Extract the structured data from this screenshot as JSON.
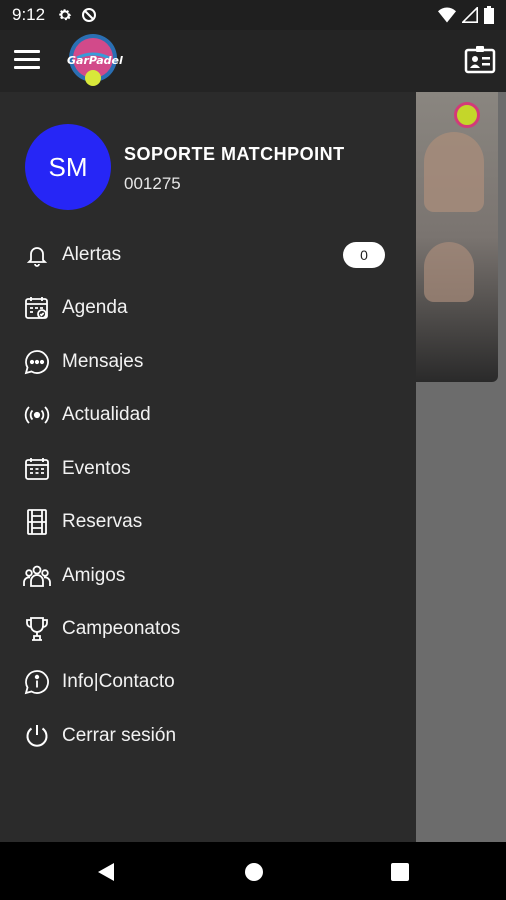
{
  "status_bar": {
    "time": "9:12"
  },
  "header": {
    "logo_icon": "garpadel-logo",
    "menu_icon": "hamburger-menu-icon",
    "profile_icon": "id-card-icon"
  },
  "user": {
    "initials": "SM",
    "name": "SOPORTE MATCHPOINT",
    "id": "001275",
    "avatar_color": "#2626f6"
  },
  "menu": {
    "items": [
      {
        "label": "Alertas",
        "icon": "bell-icon",
        "badge": "0"
      },
      {
        "label": "Agenda",
        "icon": "calendar-check-icon"
      },
      {
        "label": "Mensajes",
        "icon": "chat-bubble-icon"
      },
      {
        "label": "Actualidad",
        "icon": "broadcast-icon"
      },
      {
        "label": "Eventos",
        "icon": "calendar-grid-icon"
      },
      {
        "label": "Reservas",
        "icon": "court-icon"
      },
      {
        "label": "Amigos",
        "icon": "group-icon"
      },
      {
        "label": "Campeonatos",
        "icon": "trophy-icon"
      },
      {
        "label": "Info|Contacto",
        "icon": "info-bubble-icon"
      },
      {
        "label": "Cerrar sesión",
        "icon": "power-icon"
      }
    ]
  },
  "colors": {
    "drawer_bg": "#2b2b2b",
    "appbar_bg": "#242424",
    "scrim": "#6c6c6c"
  }
}
